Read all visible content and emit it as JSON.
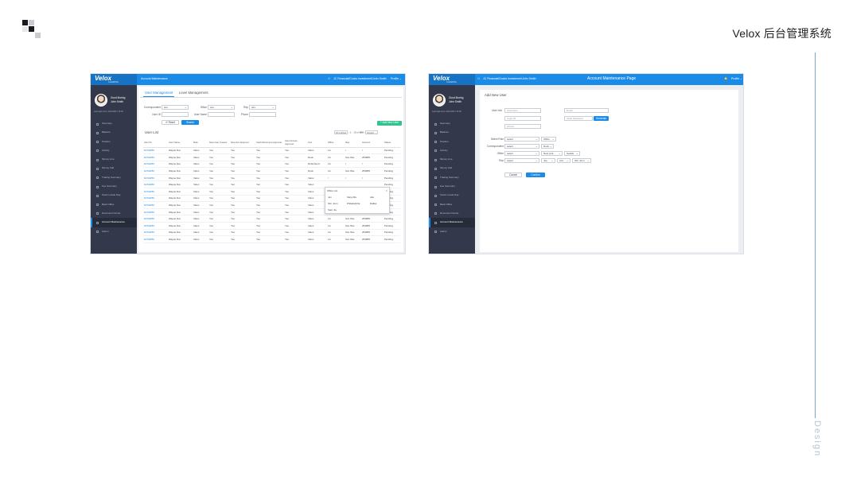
{
  "slide": {
    "title": "Velox 后台管理系统",
    "side_word": "Design",
    "colors": {
      "accent": "#1a8ce8",
      "sidebar": "#33394a",
      "brand": "#1673c4",
      "success": "#34c38f"
    }
  },
  "app": {
    "brand": "Velox",
    "brand_sub": "CLEARING",
    "user_greeting": "Good Moring",
    "user_name": "John Smith",
    "last_login": "Last login time: 02/11/2017 13:36",
    "account_text": "JC Financial/Ducks Investment/John Smith",
    "profile_label": "Profile",
    "nav": [
      {
        "label": "Summary",
        "icon": "summary-icon"
      },
      {
        "label": "Balance",
        "icon": "balance-icon"
      },
      {
        "label": "Position",
        "icon": "position-icon"
      },
      {
        "label": "Activity",
        "icon": "activity-icon"
      },
      {
        "label": "Money Line",
        "icon": "money-line-icon"
      },
      {
        "label": "Money Call",
        "icon": "money-call-icon"
      },
      {
        "label": "Trading Summary",
        "icon": "trading-summary-icon"
      },
      {
        "label": "Fee Summary",
        "icon": "fee-summary-icon"
      },
      {
        "label": "Stock Locate Day",
        "icon": "stock-locate-icon"
      },
      {
        "label": "Back Office",
        "icon": "back-office-icon"
      },
      {
        "label": "Document Center",
        "icon": "document-center-icon"
      },
      {
        "label": "Account Maintenance",
        "icon": "user-icon"
      },
      {
        "label": "Admin",
        "icon": "admin-icon"
      }
    ]
  },
  "screen1": {
    "topbar_title": "Account Maintenance",
    "tabs": [
      "User Management",
      "Level Management"
    ],
    "filters": {
      "correspondent_label": "Correspondent",
      "correspondent_value": "ALL",
      "office_label": "Office",
      "office_value": "ALL",
      "rep_label": "Rep",
      "rep_value": "ALL",
      "user_id_label": "User ID",
      "user_name_label": "User Name",
      "phone_label": "Phone"
    },
    "reset_label": "Reset",
    "search_label": "Search",
    "add_new_user_label": "+ Add New User",
    "list_title": "User List",
    "pager": {
      "per_page": "10 entries",
      "range": "1 - 10",
      "of": "of",
      "total": "999",
      "export": "Export"
    },
    "columns": [
      "User ID",
      "User Name",
      "Role",
      "New User Creator",
      "New Acc Approver",
      "Cash Movement Approver",
      "User Access Approver",
      "Corr",
      "Office",
      "Rep",
      "Account",
      "Status"
    ],
    "rows": [
      [
        "D2S4R56",
        "Wayne Dai",
        "Velox",
        "Yes",
        "Yes",
        "Yes",
        "Yes",
        "Velox",
        "LA",
        "/",
        "/",
        "Pending"
      ],
      [
        "D2S4R56",
        "Wayne Dai",
        "Velox",
        "Yes",
        "Yes",
        "Yes",
        "Yes",
        "Duck",
        "LA",
        "Sun Wei",
        "254865",
        "Pending"
      ],
      [
        "D2S4R56",
        "Wayne Dai",
        "Velox",
        "Yes",
        "Yes",
        "Yes",
        "Yes",
        "Robinhood",
        "LA",
        "/",
        "/",
        "Pending"
      ],
      [
        "D2S4R56",
        "Wayne Dai",
        "Velox",
        "Yes",
        "Yes",
        "Yes",
        "Yes",
        "Duck",
        "LA",
        "Sun Wei",
        "254865",
        "Pending"
      ],
      [
        "D2S4R56",
        "Wayne Dai",
        "Velox",
        "Yes",
        "Yes",
        "Yes",
        "Yes",
        "Velox",
        "/",
        "/",
        "/",
        "Pending"
      ],
      [
        "D2S4R56",
        "Wayne Dai",
        "Velox",
        "Yes",
        "Yes",
        "Yes",
        "Yes",
        "Velox",
        "",
        "",
        "",
        "Pending"
      ],
      [
        "D2S4R56",
        "Wayne Dai",
        "Velox",
        "Yes",
        "Yes",
        "Yes",
        "Yes",
        "Velox",
        "",
        "",
        "",
        "Pending"
      ],
      [
        "D2S4R56",
        "Wayne Dai",
        "Velox",
        "Yes",
        "Yes",
        "Yes",
        "Yes",
        "Velox",
        "",
        "",
        "",
        "Pending"
      ],
      [
        "D2S4R56",
        "Wayne Dai",
        "Velox",
        "Yes",
        "Yes",
        "Yes",
        "Yes",
        "Velox",
        "",
        "",
        "",
        "Pending"
      ],
      [
        "D2S4R56",
        "Wayne Dai",
        "Velox",
        "Yes",
        "Yes",
        "Yes",
        "Yes",
        "Velox",
        "LA",
        "Sun Wei",
        "254865",
        "Pending"
      ],
      [
        "D2S4R56",
        "Wayne Dai",
        "Velox",
        "Yes",
        "Yes",
        "Yes",
        "Yes",
        "Velox",
        "LA",
        "Sun Wei",
        "254865",
        "Pending"
      ],
      [
        "D2S4R56",
        "Wayne Dai",
        "Velox",
        "Yes",
        "Yes",
        "Yes",
        "Yes",
        "Velox",
        "LA",
        "Sun Wei",
        "254865",
        "Pending"
      ],
      [
        "D2S4R56",
        "Wayne Dai",
        "Velox",
        "Yes",
        "Yes",
        "Yes",
        "Yes",
        "Velox",
        "LA",
        "Sun Wei",
        "254865",
        "Pending"
      ],
      [
        "D2S4R56",
        "Wayne Dai",
        "Velox",
        "Yes",
        "Yes",
        "Yes",
        "Yes",
        "Velox",
        "LA",
        "Sun Wei",
        "254865",
        "Pending"
      ]
    ],
    "office_popover": {
      "title": "Office List",
      "items": [
        "Jen",
        "Vang Ma",
        "Alei",
        "Sim Joon",
        "Philadelphia",
        "Dallas",
        "Sam Jia"
      ]
    }
  },
  "screen2": {
    "topbar_title": "Account Maintenance Page",
    "form_title": "Add New User",
    "user_info_label": "User Info",
    "placeholders": {
      "username": "Username",
      "email": "Email",
      "login_id": "Login ID",
      "initial_password": "Initial Password",
      "phone": "iphone"
    },
    "generate_label": "Generate",
    "select_role_label": "Select Role",
    "correspondent_label": "Correspondent",
    "office_label": "Office",
    "rep_label": "Rep",
    "select_value": "select",
    "office_chip": "Office",
    "duck_value": "Duck",
    "new_york_value": "New york",
    "seattle_value": "Seattle",
    "joe_value": "Joe",
    "ann_value": "Ann",
    "sim_joon_value": "Sim Joon",
    "cancel_label": "Cancel",
    "confirm_label": "Confirm"
  }
}
